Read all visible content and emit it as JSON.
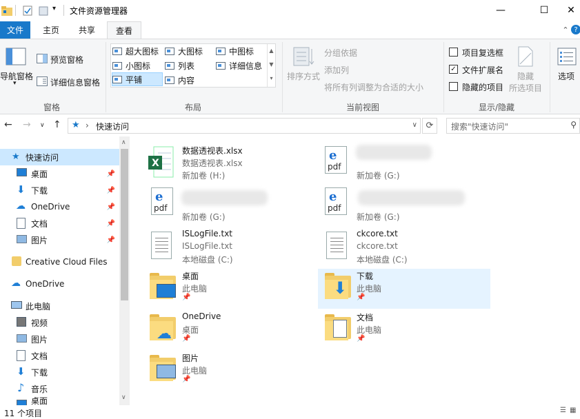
{
  "window": {
    "title": "文件资源管理器",
    "minimize": "—",
    "maximize": "☐",
    "close": "✕"
  },
  "quick_toolbar": {
    "dropdown": "▾"
  },
  "tabs": {
    "file": "文件",
    "home": "主页",
    "share": "共享",
    "view": "查看",
    "help": "?",
    "collapse": "⌃"
  },
  "ribbon": {
    "panes": {
      "label": "窗格",
      "nav_pane": "导航窗格",
      "nav_pane_arrow": "▾",
      "preview_pane": "预览窗格",
      "details_pane": "详细信息窗格"
    },
    "layout": {
      "label": "布局",
      "options": [
        "超大图标",
        "大图标",
        "中图标",
        "小图标",
        "列表",
        "详细信息",
        "平铺",
        "内容"
      ],
      "selected": "平铺"
    },
    "current_view": {
      "label": "当前视图",
      "sort_by": "排序方式",
      "group_by": "分组依据",
      "add_columns": "添加列",
      "size_all_columns": "将所有列调整为合适的大小"
    },
    "show_hide": {
      "label": "显示/隐藏",
      "item_checkboxes": "项目复选框",
      "item_checkboxes_checked": false,
      "file_extensions": "文件扩展名",
      "file_extensions_checked": true,
      "hidden_items": "隐藏的项目",
      "hidden_items_checked": false,
      "hide_selected": "隐藏",
      "hide_selected_line2": "所选项目"
    },
    "options": {
      "label": "选项"
    }
  },
  "address": {
    "path": "快速访问",
    "search_placeholder": "搜索\"快速访问\"",
    "sep": "›"
  },
  "nav": {
    "items": [
      {
        "label": "快速访问",
        "pinned": false
      },
      {
        "label": "桌面",
        "pinned": true
      },
      {
        "label": "下载",
        "pinned": true
      },
      {
        "label": "OneDrive",
        "pinned": true
      },
      {
        "label": "文档",
        "pinned": true
      },
      {
        "label": "图片",
        "pinned": true
      },
      {
        "label": "Creative Cloud Files",
        "pinned": false
      },
      {
        "label": "OneDrive",
        "pinned": false
      },
      {
        "label": "此电脑",
        "pinned": false
      },
      {
        "label": "视频",
        "pinned": false
      },
      {
        "label": "图片",
        "pinned": false
      },
      {
        "label": "文档",
        "pinned": false
      },
      {
        "label": "下载",
        "pinned": false
      },
      {
        "label": "音乐",
        "pinned": false
      },
      {
        "label": "桌面",
        "pinned": false
      }
    ]
  },
  "files": [
    {
      "name": "数据透视表.xlsx",
      "line2": "数据透视表.xlsx",
      "line3": "新加卷 (H:)",
      "icon": "excel-icon"
    },
    {
      "name": "",
      "line2": "",
      "line3": "新加卷 (G:)",
      "icon": "pdf-icon"
    },
    {
      "name": "",
      "line2": "",
      "line3": "新加卷 (G:)",
      "icon": "pdf-icon"
    },
    {
      "name": "",
      "line2": "",
      "line3": "新加卷 (G:)",
      "icon": "pdf-icon"
    },
    {
      "name": "ISLogFile.txt",
      "line2": "ISLogFile.txt",
      "line3": "本地磁盘 (C:)",
      "icon": "text-file-icon"
    },
    {
      "name": "ckcore.txt",
      "line2": "ckcore.txt",
      "line3": "本地磁盘 (C:)",
      "icon": "text-file-icon"
    },
    {
      "name": "桌面",
      "line2": "此电脑",
      "line3": "",
      "icon": "desktop-folder-icon"
    },
    {
      "name": "下载",
      "line2": "此电脑",
      "line3": "",
      "icon": "downloads-folder-icon"
    },
    {
      "name": "OneDrive",
      "line2": "桌面",
      "line3": "",
      "icon": "onedrive-folder-icon"
    },
    {
      "name": "文档",
      "line2": "此电脑",
      "line3": "",
      "icon": "documents-folder-icon"
    },
    {
      "name": "图片",
      "line2": "此电脑",
      "line3": "",
      "icon": "pictures-folder-icon"
    }
  ],
  "status": {
    "count": "11 个项目"
  },
  "colors": {
    "accent": "#1979ca",
    "selection": "#cce8ff",
    "hover": "#e5f3ff"
  }
}
